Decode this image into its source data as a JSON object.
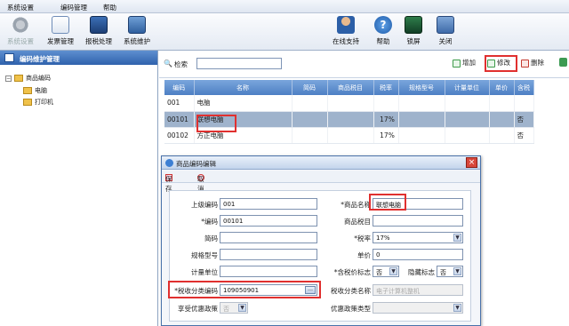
{
  "menu": {
    "items": [
      "系统设置",
      "编码管理",
      "帮助"
    ]
  },
  "toolbar": {
    "left": [
      {
        "label": "系统设置",
        "icon": "gear-icon",
        "disabled": true
      },
      {
        "label": "发票管理",
        "icon": "invoice-icon",
        "disabled": false
      },
      {
        "label": "报税处理",
        "icon": "monitor-icon",
        "disabled": false
      },
      {
        "label": "系统维护",
        "icon": "maintenance-icon",
        "disabled": false
      }
    ],
    "right": [
      {
        "label": "在线支持",
        "icon": "person-icon"
      },
      {
        "label": "帮助",
        "icon": "help-icon"
      },
      {
        "label": "锁屏",
        "icon": "lock-icon"
      },
      {
        "label": "关闭",
        "icon": "close-icon"
      }
    ]
  },
  "sidebar": {
    "title": "编码维护管理",
    "tree": {
      "root": "商品编码",
      "children": [
        "电脑",
        "打印机"
      ]
    }
  },
  "search": {
    "label": "检索",
    "value": ""
  },
  "actions": {
    "add": "增加",
    "edit": "修改",
    "delete": "删除"
  },
  "table": {
    "columns": [
      "编码",
      "名称",
      "简码",
      "商品税目",
      "税率",
      "规格型号",
      "计量单位",
      "单价",
      "含税"
    ],
    "rows": [
      {
        "cells": [
          "001",
          "电脑",
          "",
          "",
          "",
          "",
          "",
          "",
          ""
        ],
        "selected": false
      },
      {
        "cells": [
          "00101",
          "联想电脑",
          "",
          "",
          "17%",
          "",
          "",
          "",
          "否"
        ],
        "selected": true
      },
      {
        "cells": [
          "00102",
          "方正电脑",
          "",
          "",
          "17%",
          "",
          "",
          "",
          "否"
        ],
        "selected": false
      }
    ]
  },
  "dialog": {
    "title": "商品编码编辑",
    "save": "保存",
    "cancel": "取消",
    "close": "×",
    "fields": {
      "parent_code": {
        "label": "上级编码",
        "value": "001"
      },
      "product_name": {
        "label": "*商品名称",
        "value": "联想电脑"
      },
      "code": {
        "label": "*编码",
        "value": "00101"
      },
      "tax_item": {
        "label": "商品税目",
        "value": ""
      },
      "short_code": {
        "label": "简码",
        "value": ""
      },
      "tax_rate": {
        "label": "*税率",
        "value": "17%"
      },
      "spec": {
        "label": "规格型号",
        "value": ""
      },
      "unit_price": {
        "label": "单价",
        "value": "0"
      },
      "unit": {
        "label": "计量单位",
        "value": ""
      },
      "tax_incl": {
        "label": "*含税价标志",
        "value": "否"
      },
      "hidden_flag": {
        "label": "隐藏标志",
        "value": "否"
      },
      "tax_class_code": {
        "label": "*税收分类编码",
        "value": "109050901"
      },
      "tax_class_name": {
        "label": "税收分类名称",
        "value": "电子计算机整机"
      },
      "preferential": {
        "label": "享受优惠政策",
        "value": "否"
      },
      "preferential_type": {
        "label": "优惠政策类型",
        "value": ""
      }
    }
  },
  "colors": {
    "accent": "#e0302f",
    "header": "#4d7fc4"
  }
}
